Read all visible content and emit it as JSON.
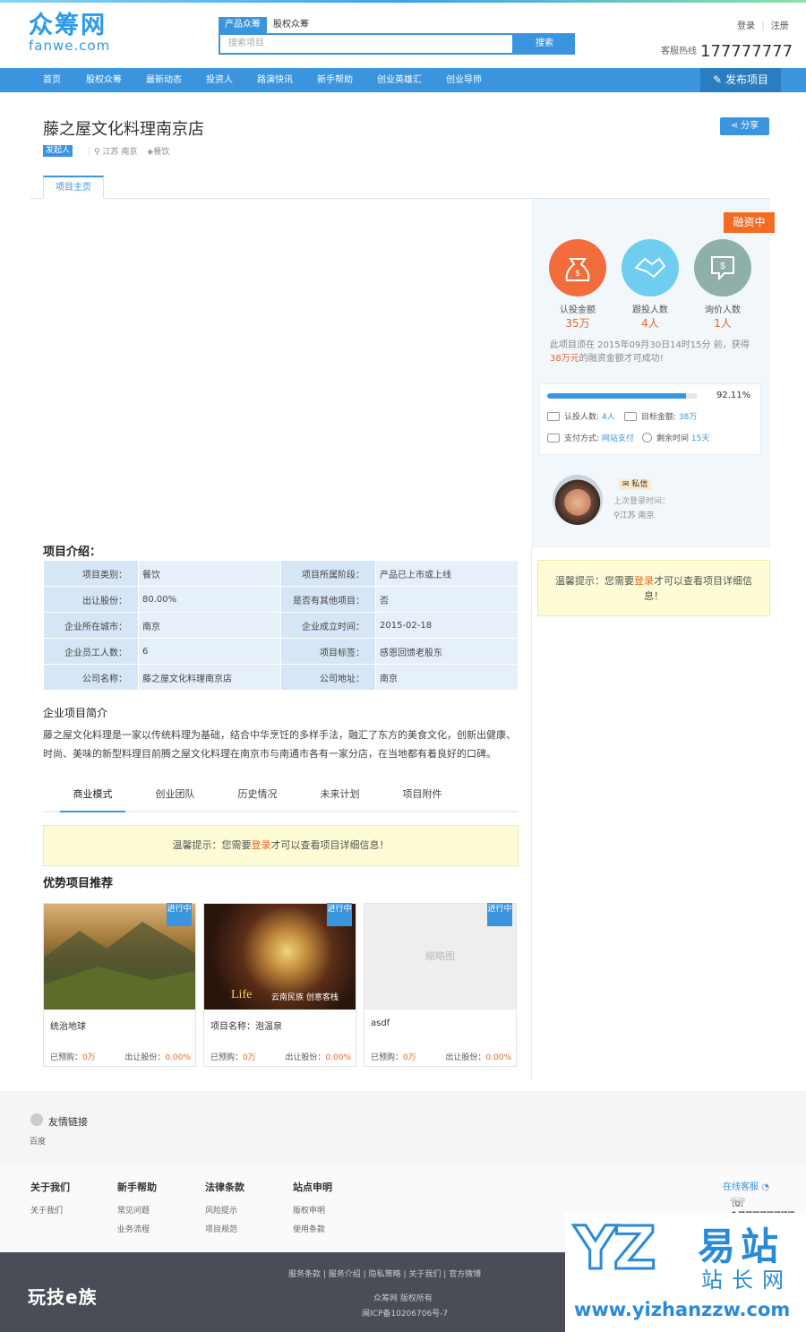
{
  "header": {
    "logo_cn": "众筹网",
    "logo_en": "fanwe.com",
    "search_tabs": [
      "产品众筹",
      "股权众筹"
    ],
    "search_placeholder": "搜索项目",
    "search_button": "搜索",
    "login": "登录",
    "register": "注册",
    "hotline_label": "客服热线",
    "hotline_number": "177777777"
  },
  "nav": {
    "items": [
      "首页",
      "股权众筹",
      "最新动态",
      "投资人",
      "路演快讯",
      "新手帮助",
      "创业英雄汇",
      "创业导师"
    ],
    "publish": "发布项目"
  },
  "project": {
    "title": "藤之屋文化料理南京店",
    "initiator_tag": "发起人",
    "location": "江苏 南京",
    "category_tag": "餐饮",
    "share": "分享",
    "tab_home": "项目主页"
  },
  "sidebar": {
    "status": "融资中",
    "circles": [
      {
        "label": "认投金额",
        "value": "35万",
        "color": "#f26c3c",
        "icon": "money-bag-icon"
      },
      {
        "label": "跟投人数",
        "value": "4人",
        "color": "#6fcdf0",
        "icon": "handshake-icon"
      },
      {
        "label": "询价人数",
        "value": "1人",
        "color": "#8fb0a8",
        "icon": "dollar-chat-icon"
      }
    ],
    "deadline_prefix": "此项目须在 2015年09月30日14时15分 前，获得",
    "deadline_amount": "38万元",
    "deadline_suffix": "的融资金额才可成功!",
    "progress_percent": 92.11,
    "progress_text": "92.11%",
    "investors_label": "认投人数:",
    "investors_value": "4人",
    "target_label": "目标金额:",
    "target_value": "38万",
    "payment_label": "支付方式:",
    "payment_value": "网站支付",
    "remaining_label": "剩余时间",
    "remaining_value": "15天",
    "message": "私信",
    "last_login": "上次登录时间：",
    "user_location": "江苏 南京"
  },
  "tip": {
    "prefix": "温馨提示：您需要",
    "link": "登录",
    "suffix": "才可以查看项目详细信息！"
  },
  "info": {
    "heading": "项目介绍：",
    "rows": [
      [
        "项目类别：",
        "餐饮",
        "项目所属阶段：",
        "产品已上市或上线"
      ],
      [
        "出让股份：",
        "80.00%",
        "是否有其他项目：",
        "否"
      ],
      [
        "企业所在城市：",
        "南京",
        "企业成立时间：",
        "2015-02-18"
      ],
      [
        "企业员工人数：",
        "6",
        "项目标签：",
        "感恩回馈老股东"
      ],
      [
        "公司名称：",
        "藤之屋文化料理南京店",
        "公司地址：",
        "南京"
      ]
    ],
    "intro_heading": "企业项目简介",
    "intro_text": "藤之屋文化料理是一家以传统料理为基础，结合中华烹饪的多样手法，融汇了东方的美食文化，创新出健康、时尚、美味的新型料理目前腾之屋文化料理在南京市与南通市各有一家分店，在当地都有着良好的口碑。"
  },
  "tabs2": [
    "商业模式",
    "创业团队",
    "历史情况",
    "未来计划",
    "项目附件"
  ],
  "recommend": {
    "heading": "优势项目推荐",
    "badge": "进行中",
    "cards": [
      {
        "name": "统治地球",
        "raised_label": "已预购：",
        "raised": "0万",
        "share_label": "出让股份：",
        "share": "0.00%"
      },
      {
        "name": "项目名称：泡温泉",
        "raised_label": "已预购：",
        "raised": "0万",
        "share_label": "出让股份：",
        "share": "0.00%"
      },
      {
        "name": "asdf",
        "raised_label": "已预购：",
        "raised": "0万",
        "share_label": "出让股份：",
        "share": "0.00%",
        "placeholder": "缩略图"
      }
    ],
    "img2_caption_en": "Life",
    "img2_caption_cn": "云南民族 创意客栈"
  },
  "friend_links": {
    "heading": "友情链接",
    "items": [
      "百度"
    ]
  },
  "footer": {
    "cols": [
      {
        "title": "关于我们",
        "links": [
          "关于我们"
        ]
      },
      {
        "title": "新手帮助",
        "links": [
          "常见问题",
          "业务流程"
        ]
      },
      {
        "title": "法律条款",
        "links": [
          "风险提示",
          "项目规范"
        ]
      },
      {
        "title": "站点申明",
        "links": [
          "版权申明",
          "使用条款"
        ]
      }
    ],
    "online_service": "在线客服",
    "phone": "177777777",
    "brand": "玩技e族",
    "bottom_links": [
      "服务条款",
      "服务介绍",
      "隐私策略",
      "关于我们",
      "官方微博"
    ],
    "copyright": "众筹网 版权所有",
    "icp": "闽ICP备10206706号-7"
  },
  "watermark": {
    "letters": "YZ",
    "cn1": "易站",
    "cn2": "站长网",
    "url": "www.yizhanzzw.com"
  }
}
